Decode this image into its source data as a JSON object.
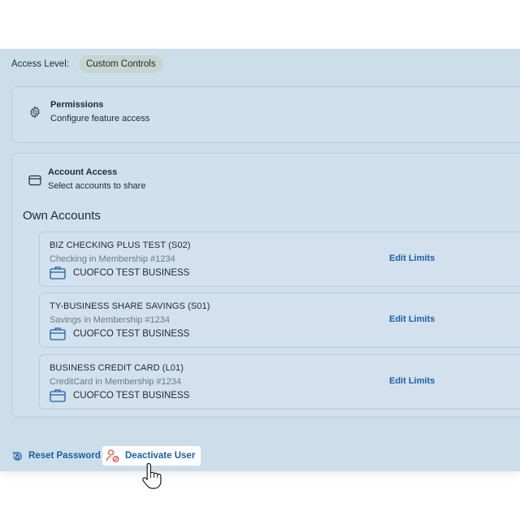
{
  "access": {
    "label": "Access Level:",
    "chip": "Custom Controls"
  },
  "permissions": {
    "icon": "gear-icon",
    "title": "Permissions",
    "subtitle": "Configure feature access"
  },
  "account_access": {
    "icon": "card-icon",
    "title": "Account Access",
    "subtitle": "Select accounts to share"
  },
  "own_accounts": {
    "heading": "Own Accounts",
    "items": [
      {
        "name": "BIZ CHECKING PLUS TEST (S02)",
        "type": "Checking in Membership #1234",
        "owner": "CUOFCO TEST BUSINESS",
        "action": "Edit Limits"
      },
      {
        "name": "TY-BUSINESS SHARE SAVINGS (S01)",
        "type": "Savings in Membership #1234",
        "owner": "CUOFCO TEST BUSINESS",
        "action": "Edit Limits"
      },
      {
        "name": "BUSINESS CREDIT CARD (L01)",
        "type": "CreditCard in Membership #1234",
        "owner": "CUOFCO TEST BUSINESS",
        "action": "Edit Limits"
      }
    ]
  },
  "footer": {
    "reset_label": "Reset Password",
    "deactivate_label": "Deactivate User"
  },
  "colors": {
    "panel_bg": "#cddeeb",
    "link": "#1c5fa8",
    "danger_icon": "#e0504e"
  }
}
